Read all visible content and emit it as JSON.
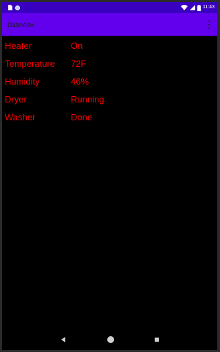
{
  "status_bar": {
    "time": "11:43",
    "icons": [
      "sim-card-icon",
      "notification-circle-icon",
      "wifi-icon",
      "cellular-signal-icon",
      "battery-icon"
    ],
    "background_color": "#3a00c0"
  },
  "app_bar": {
    "title": "DateView",
    "overflow_icon": "more-vert-icon",
    "background_color": "#6200ee"
  },
  "rows": [
    {
      "label": "Heater",
      "value": "On"
    },
    {
      "label": "Temperature",
      "value": "72F"
    },
    {
      "label": "Humidity",
      "value": "46%"
    },
    {
      "label": "Dryer",
      "value": "Running"
    },
    {
      "label": "Washer",
      "value": "Done"
    }
  ],
  "colors": {
    "text": "#ff0000",
    "content_background": "#000000"
  },
  "nav_bar": {
    "icons": [
      "back-icon",
      "home-icon",
      "recents-icon"
    ]
  }
}
